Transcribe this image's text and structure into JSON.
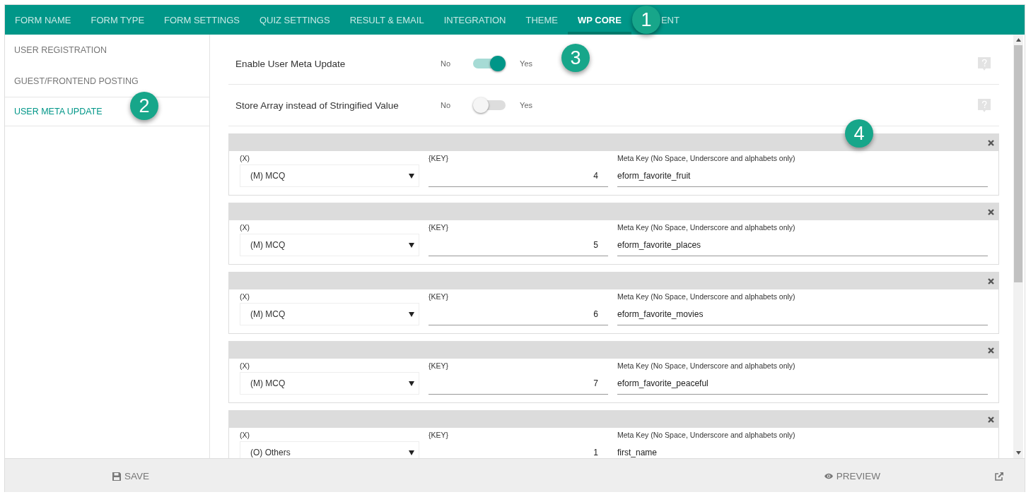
{
  "tabs": [
    {
      "label": "FORM NAME",
      "selected": false
    },
    {
      "label": "FORM TYPE",
      "selected": false
    },
    {
      "label": "FORM SETTINGS",
      "selected": false
    },
    {
      "label": "QUIZ SETTINGS",
      "selected": false
    },
    {
      "label": "RESULT & EMAIL",
      "selected": false
    },
    {
      "label": "INTEGRATION",
      "selected": false
    },
    {
      "label": "THEME",
      "selected": false
    },
    {
      "label": "WP CORE",
      "selected": true
    },
    {
      "label": "ENT",
      "selected": false
    }
  ],
  "sidebar": {
    "items": [
      {
        "label": "USER REGISTRATION",
        "selected": false
      },
      {
        "label": "GUEST/FRONTEND POSTING",
        "selected": false
      },
      {
        "label": "USER META UPDATE",
        "selected": true
      }
    ]
  },
  "settings": [
    {
      "label": "Enable User Meta Update",
      "off_label": "No",
      "on_label": "Yes",
      "on": true
    },
    {
      "label": "Store Array instead of Stringified Value",
      "off_label": "No",
      "on_label": "Yes",
      "on": false
    }
  ],
  "mappings": [
    {
      "type_label": "(X)",
      "type_value": "(M) MCQ",
      "key_label": "{KEY}",
      "key_value": "4",
      "meta_label": "Meta Key (No Space, Underscore and alphabets only)",
      "meta_value": "eform_favorite_fruit"
    },
    {
      "type_label": "(X)",
      "type_value": "(M) MCQ",
      "key_label": "{KEY}",
      "key_value": "5",
      "meta_label": "Meta Key (No Space, Underscore and alphabets only)",
      "meta_value": "eform_favorite_places"
    },
    {
      "type_label": "(X)",
      "type_value": "(M) MCQ",
      "key_label": "{KEY}",
      "key_value": "6",
      "meta_label": "Meta Key (No Space, Underscore and alphabets only)",
      "meta_value": "eform_favorite_movies"
    },
    {
      "type_label": "(X)",
      "type_value": "(M) MCQ",
      "key_label": "{KEY}",
      "key_value": "7",
      "meta_label": "Meta Key (No Space, Underscore and alphabets only)",
      "meta_value": "eform_favorite_peaceful"
    },
    {
      "type_label": "(X)",
      "type_value": "(O) Others",
      "key_label": "{KEY}",
      "key_value": "1",
      "meta_label": "Meta Key (No Space, Underscore and alphabets only)",
      "meta_value": "first_name"
    }
  ],
  "footer": {
    "save": "SAVE",
    "preview": "PREVIEW"
  },
  "callouts": [
    {
      "text": "1"
    },
    {
      "text": "2"
    },
    {
      "text": "3"
    },
    {
      "text": "4"
    }
  ]
}
